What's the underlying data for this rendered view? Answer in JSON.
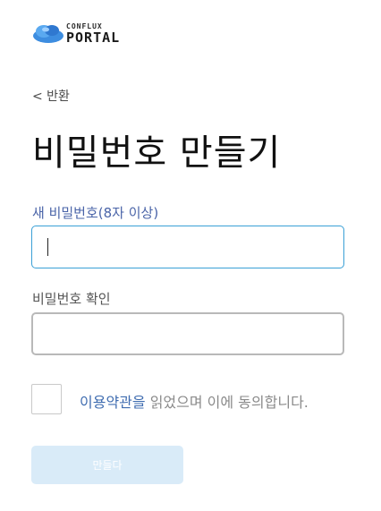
{
  "brand": {
    "name_top": "CONFLUX",
    "name_bottom": "PORTAL",
    "logo_color": "#3d8de0"
  },
  "nav": {
    "back_label": "< 반환"
  },
  "page": {
    "title": "비밀번호 만들기"
  },
  "form": {
    "new_password": {
      "label": "새 비밀번호(8자 이상)",
      "value": "",
      "focused": true,
      "accent_color": "#3aa0d6"
    },
    "confirm_password": {
      "label": "비밀번호 확인",
      "value": ""
    },
    "agreement": {
      "checked": false,
      "terms_link": "이용약관을",
      "suffix": " 읽었으며 이에 동의합니다."
    },
    "submit": {
      "label": "만들다",
      "disabled": true,
      "bg_color": "#d9ebf8"
    }
  }
}
